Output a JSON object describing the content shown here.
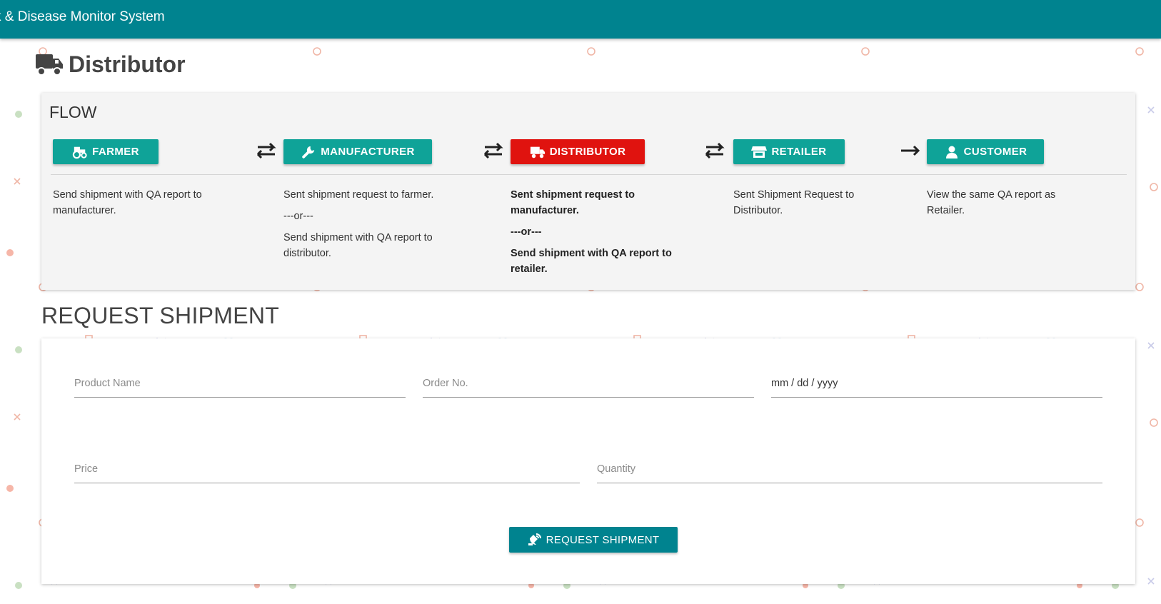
{
  "header": {
    "app_title": "k & Disease Monitor System"
  },
  "page": {
    "title": "Distributor",
    "title_icon": "truck-icon"
  },
  "flow": {
    "title": "FLOW",
    "stages": [
      {
        "label": "FARMER",
        "icon": "tractor-icon",
        "active": false
      },
      {
        "label": "MANUFACTURER",
        "icon": "wrench-icon",
        "active": false
      },
      {
        "label": "DISTRIBUTOR",
        "icon": "truck-icon",
        "active": true
      },
      {
        "label": "RETAILER",
        "icon": "store-icon",
        "active": false
      },
      {
        "label": "CUSTOMER",
        "icon": "user-icon",
        "active": false
      }
    ],
    "descriptions": {
      "farmer": {
        "line1": "Send shipment with QA report to manufacturer."
      },
      "manufacturer": {
        "line1": "Sent shipment request to farmer.",
        "separator": "---or---",
        "line2": "Send shipment with QA report to distributor."
      },
      "distributor": {
        "line1": "Sent shipment request to manufacturer.",
        "separator": "---or---",
        "line2": "Send shipment with QA report to retailer."
      },
      "retailer": {
        "line1": "Sent Shipment Request to Distributor."
      },
      "customer": {
        "line1": "View the same QA report as Retailer."
      }
    },
    "arrows": [
      "exchange-arrows-icon",
      "exchange-arrows-icon",
      "exchange-arrows-icon",
      "right-arrow-icon"
    ]
  },
  "request_shipment": {
    "title": "REQUEST SHIPMENT",
    "fields": {
      "product_name": {
        "placeholder": "Product Name",
        "value": ""
      },
      "order_no": {
        "placeholder": "Order No.",
        "value": ""
      },
      "date": {
        "placeholder": "mm / dd / yyyy",
        "value": ""
      },
      "price": {
        "placeholder": "Price",
        "value": ""
      },
      "quantity": {
        "placeholder": "Quantity",
        "value": ""
      }
    },
    "submit_label": "REQUEST SHIPMENT",
    "submit_icon": "satellite-dish-icon"
  },
  "colors": {
    "topbar": "#00838f",
    "stage_button": "#0fa398",
    "active_stage_button": "#e0130f",
    "submit_button": "#00838f"
  }
}
